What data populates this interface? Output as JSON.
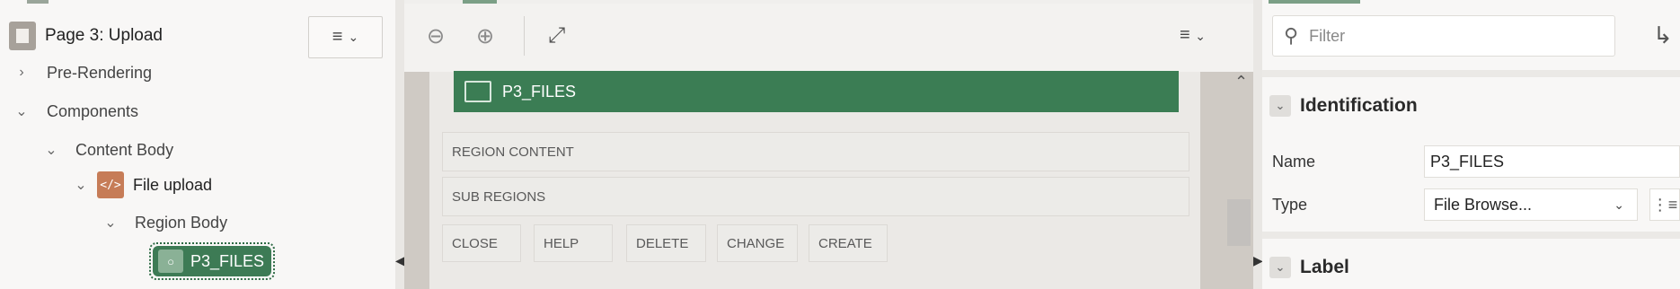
{
  "tree": {
    "page_title": "Page 3: Upload",
    "menu_icon": "hamburger-menu-icon",
    "nodes": [
      {
        "label": "Pre-Rendering"
      },
      {
        "label": "Components"
      },
      {
        "label": "Content Body"
      },
      {
        "label": "File upload",
        "icon": "code-icon"
      },
      {
        "label": "Region Body"
      }
    ],
    "selected_item": "P3_FILES"
  },
  "center": {
    "toolbar": {
      "zoom_out_icon": "zoom-out-icon",
      "zoom_in_icon": "zoom-in-icon",
      "expand_icon": "expand-icon",
      "menu_icon": "hamburger-menu-icon"
    },
    "region_item": "P3_FILES",
    "drop_zones": [
      "REGION CONTENT",
      "SUB REGIONS"
    ],
    "position_buttons": [
      "CLOSE",
      "HELP",
      "DELETE",
      "CHANGE",
      "CREATE"
    ]
  },
  "props": {
    "filter_placeholder": "Filter",
    "sections": {
      "identification": "Identification",
      "label": "Label"
    },
    "fields": {
      "name_label": "Name",
      "name_value": "P3_FILES",
      "type_label": "Type",
      "type_value": "File Browse..."
    }
  },
  "colors": {
    "accent_green": "#3b7d54",
    "component_orange": "#c67c57"
  }
}
